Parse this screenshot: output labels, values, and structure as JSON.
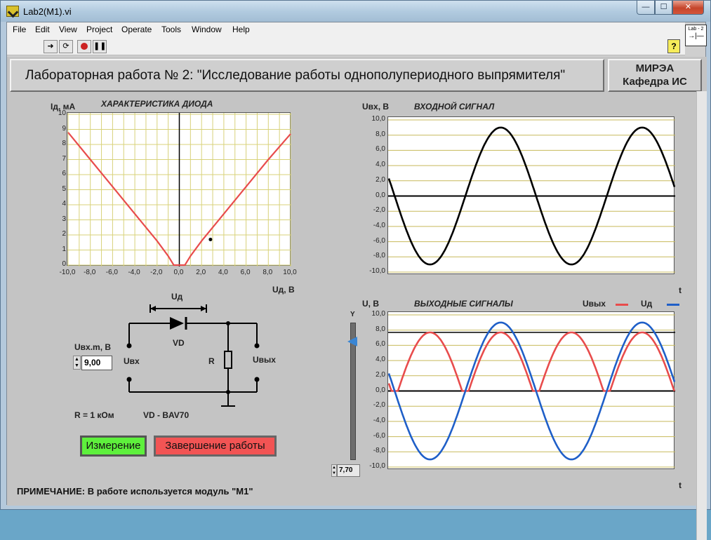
{
  "window": {
    "title": "Lab2(M1).vi",
    "min": "—",
    "max": "☐",
    "close": "✕"
  },
  "menu": [
    "File",
    "Edit",
    "View",
    "Project",
    "Operate",
    "Tools",
    "Window",
    "Help"
  ],
  "toolbar": {
    "help": "?",
    "vi_icon_label": "Lab - 2",
    "vi_icon_symbol": "→|—"
  },
  "header": {
    "title": "Лабораторная работа № 2: \"Исследование работы однополупериодного выпрямителя\"",
    "org_line1": "МИРЭА",
    "org_line2": "Кафедра ИС"
  },
  "diode_plot": {
    "title": "ХАРАКТЕРИСТИКА ДИОДА",
    "ylabel": "Iд, мА",
    "xlabel": "Uд, В",
    "xticks": [
      "-10,0",
      "-8,0",
      "-6,0",
      "-4,0",
      "-2,0",
      "0,0",
      "2,0",
      "4,0",
      "6,0",
      "8,0",
      "10,0"
    ],
    "yticks": [
      "10",
      "9",
      "8",
      "7",
      "6",
      "5",
      "4",
      "3",
      "2",
      "1",
      "0"
    ]
  },
  "input_plot": {
    "title": "ВХОДНОЙ СИГНАЛ",
    "ylabel": "Uвх, В",
    "xlabel": "t",
    "yticks": [
      "10,0",
      "8,0",
      "6,0",
      "4,0",
      "2,0",
      "0,0",
      "-2,0",
      "-4,0",
      "-6,0",
      "-8,0",
      "-10,0"
    ]
  },
  "output_plot": {
    "title": "ВЫХОДНЫЕ СИГНАЛЫ",
    "ylabel": "U, В",
    "xlabel": "t",
    "legend": [
      {
        "name": "Uвых",
        "color": "#e84c4c"
      },
      {
        "name": "Uд",
        "color": "#1f5fc8"
      }
    ],
    "yticks": [
      "10,0",
      "8,0",
      "6,0",
      "4,0",
      "2,0",
      "0,0",
      "-2,0",
      "-4,0",
      "-6,0",
      "-8,0",
      "-10,0"
    ],
    "slider_label": "Y",
    "slider_value": "7,70"
  },
  "schematic": {
    "ud_label": "Uд",
    "vd_label": "VD",
    "r_label": "R",
    "uin_label": "Uвх",
    "uout_label": "Uвых",
    "r_value": "R = 1 кОм",
    "vd_model": "VD - BAV70"
  },
  "controls": {
    "uin_label": "Uвх.m, В",
    "uin_value": "9,00",
    "measure_button": "Измерение",
    "finish_button": "Завершение работы"
  },
  "note": "ПРИМЕЧАНИЕ: В работе используется модуль \"М1\"",
  "chart_data": [
    {
      "type": "line",
      "title": "ХАРАКТЕРИСТИКА ДИОДА",
      "xlabel": "Uд, В",
      "ylabel": "Iд, мА",
      "xlim": [
        -10,
        10
      ],
      "ylim": [
        0,
        10
      ],
      "grid": true,
      "series": [
        {
          "color": "#e84c4c",
          "x": [
            -10.0,
            -8.0,
            -6.0,
            -4.0,
            -2.0,
            -1.0,
            -0.5,
            0.5,
            1.0,
            2.0,
            4.0,
            6.0,
            8.0,
            10.0
          ],
          "y": [
            8.8,
            7.0,
            5.2,
            3.4,
            1.6,
            0.6,
            0.0,
            0.0,
            0.6,
            1.6,
            3.4,
            5.2,
            7.0,
            8.7
          ]
        }
      ],
      "marker": {
        "x": 2.8,
        "y": 1.7
      }
    },
    {
      "type": "line",
      "title": "ВХОДНОЙ СИГНАЛ",
      "xlabel": "t",
      "ylabel": "Uвх, В",
      "ylim": [
        -10,
        10
      ],
      "grid": true,
      "series": [
        {
          "color": "#000000",
          "amplitude": 9.0,
          "periods": 2.02,
          "start_value": 2.3
        }
      ]
    },
    {
      "type": "line",
      "title": "ВЫХОДНЫЕ СИГНАЛЫ",
      "xlabel": "t",
      "ylabel": "U, В",
      "ylim": [
        -10,
        10
      ],
      "grid": true,
      "series": [
        {
          "name": "Uвых",
          "color": "#e84c4c",
          "amplitude": 7.7,
          "rectified": true
        },
        {
          "name": "Uд",
          "color": "#1f5fc8",
          "amplitude": 9.0,
          "start_value": 2.3
        }
      ],
      "cursor_level": 7.7
    }
  ]
}
